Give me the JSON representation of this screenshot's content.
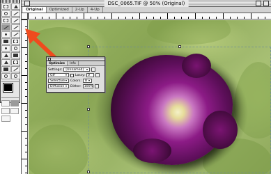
{
  "window": {
    "title": "DSC_0065.TIF @ 50% (Original)",
    "tabs": [
      "Original",
      "Optimized",
      "2-Up",
      "4-Up"
    ],
    "active_tab": "Original"
  },
  "colors": {
    "arrow": "#ef4b1e",
    "flower_core": "#f4f1c8",
    "flower_petal": "#8c1b86",
    "foliage": "#9cb865"
  },
  "toolbox": {
    "tools": [
      "marquee-icon",
      "move-icon",
      "lasso-icon",
      "magic-wand-icon",
      "crop-icon",
      "slice-icon",
      "brush-icon",
      "pencil-icon",
      "stamp-icon",
      "history-brush-icon",
      "eraser-icon",
      "gradient-icon",
      "blur-icon",
      "dodge-icon",
      "path-icon",
      "type-icon",
      "pen-icon",
      "shape-icon",
      "notes-icon",
      "eyedropper-icon",
      "hand-icon",
      "zoom-icon"
    ],
    "active_tool": "brush-icon"
  },
  "palette": {
    "tabs": [
      "Optimize",
      "Info"
    ],
    "settings_label": "Settings:",
    "settings_value": "[Unnamed]",
    "format_value": "GIF",
    "reduction_value": "Selective",
    "dither_algo_value": "Diffusion",
    "colors_label": "Colors:",
    "colors_value": "8",
    "lossy_label": "Lossy:",
    "lossy_value": "0",
    "dither_label": "Dither:",
    "dither_value": "100%"
  }
}
